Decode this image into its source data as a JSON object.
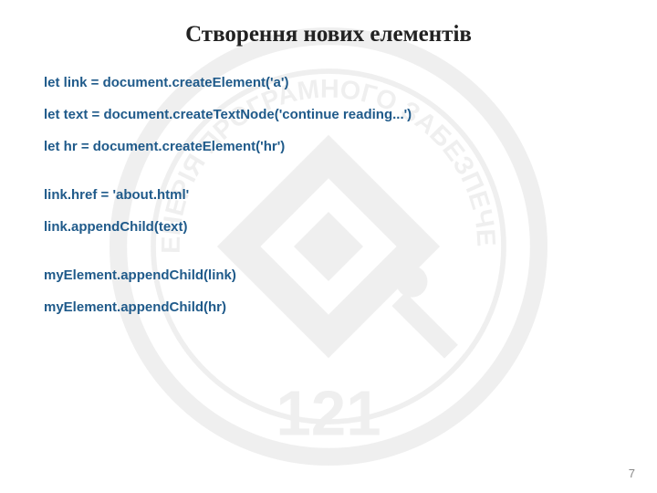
{
  "title": "Створення нових елементів",
  "code": {
    "line1": "let link = document.createElement('a')",
    "line2": "let text = document.createTextNode('continue reading...')",
    "line3": "let hr = document.createElement('hr')",
    "line4": "link.href = 'about.html'",
    "line5": "link.appendChild(text)",
    "line6": "myElement.appendChild(link)",
    "line7": "myElement.appendChild(hr)"
  },
  "page_number": "7"
}
